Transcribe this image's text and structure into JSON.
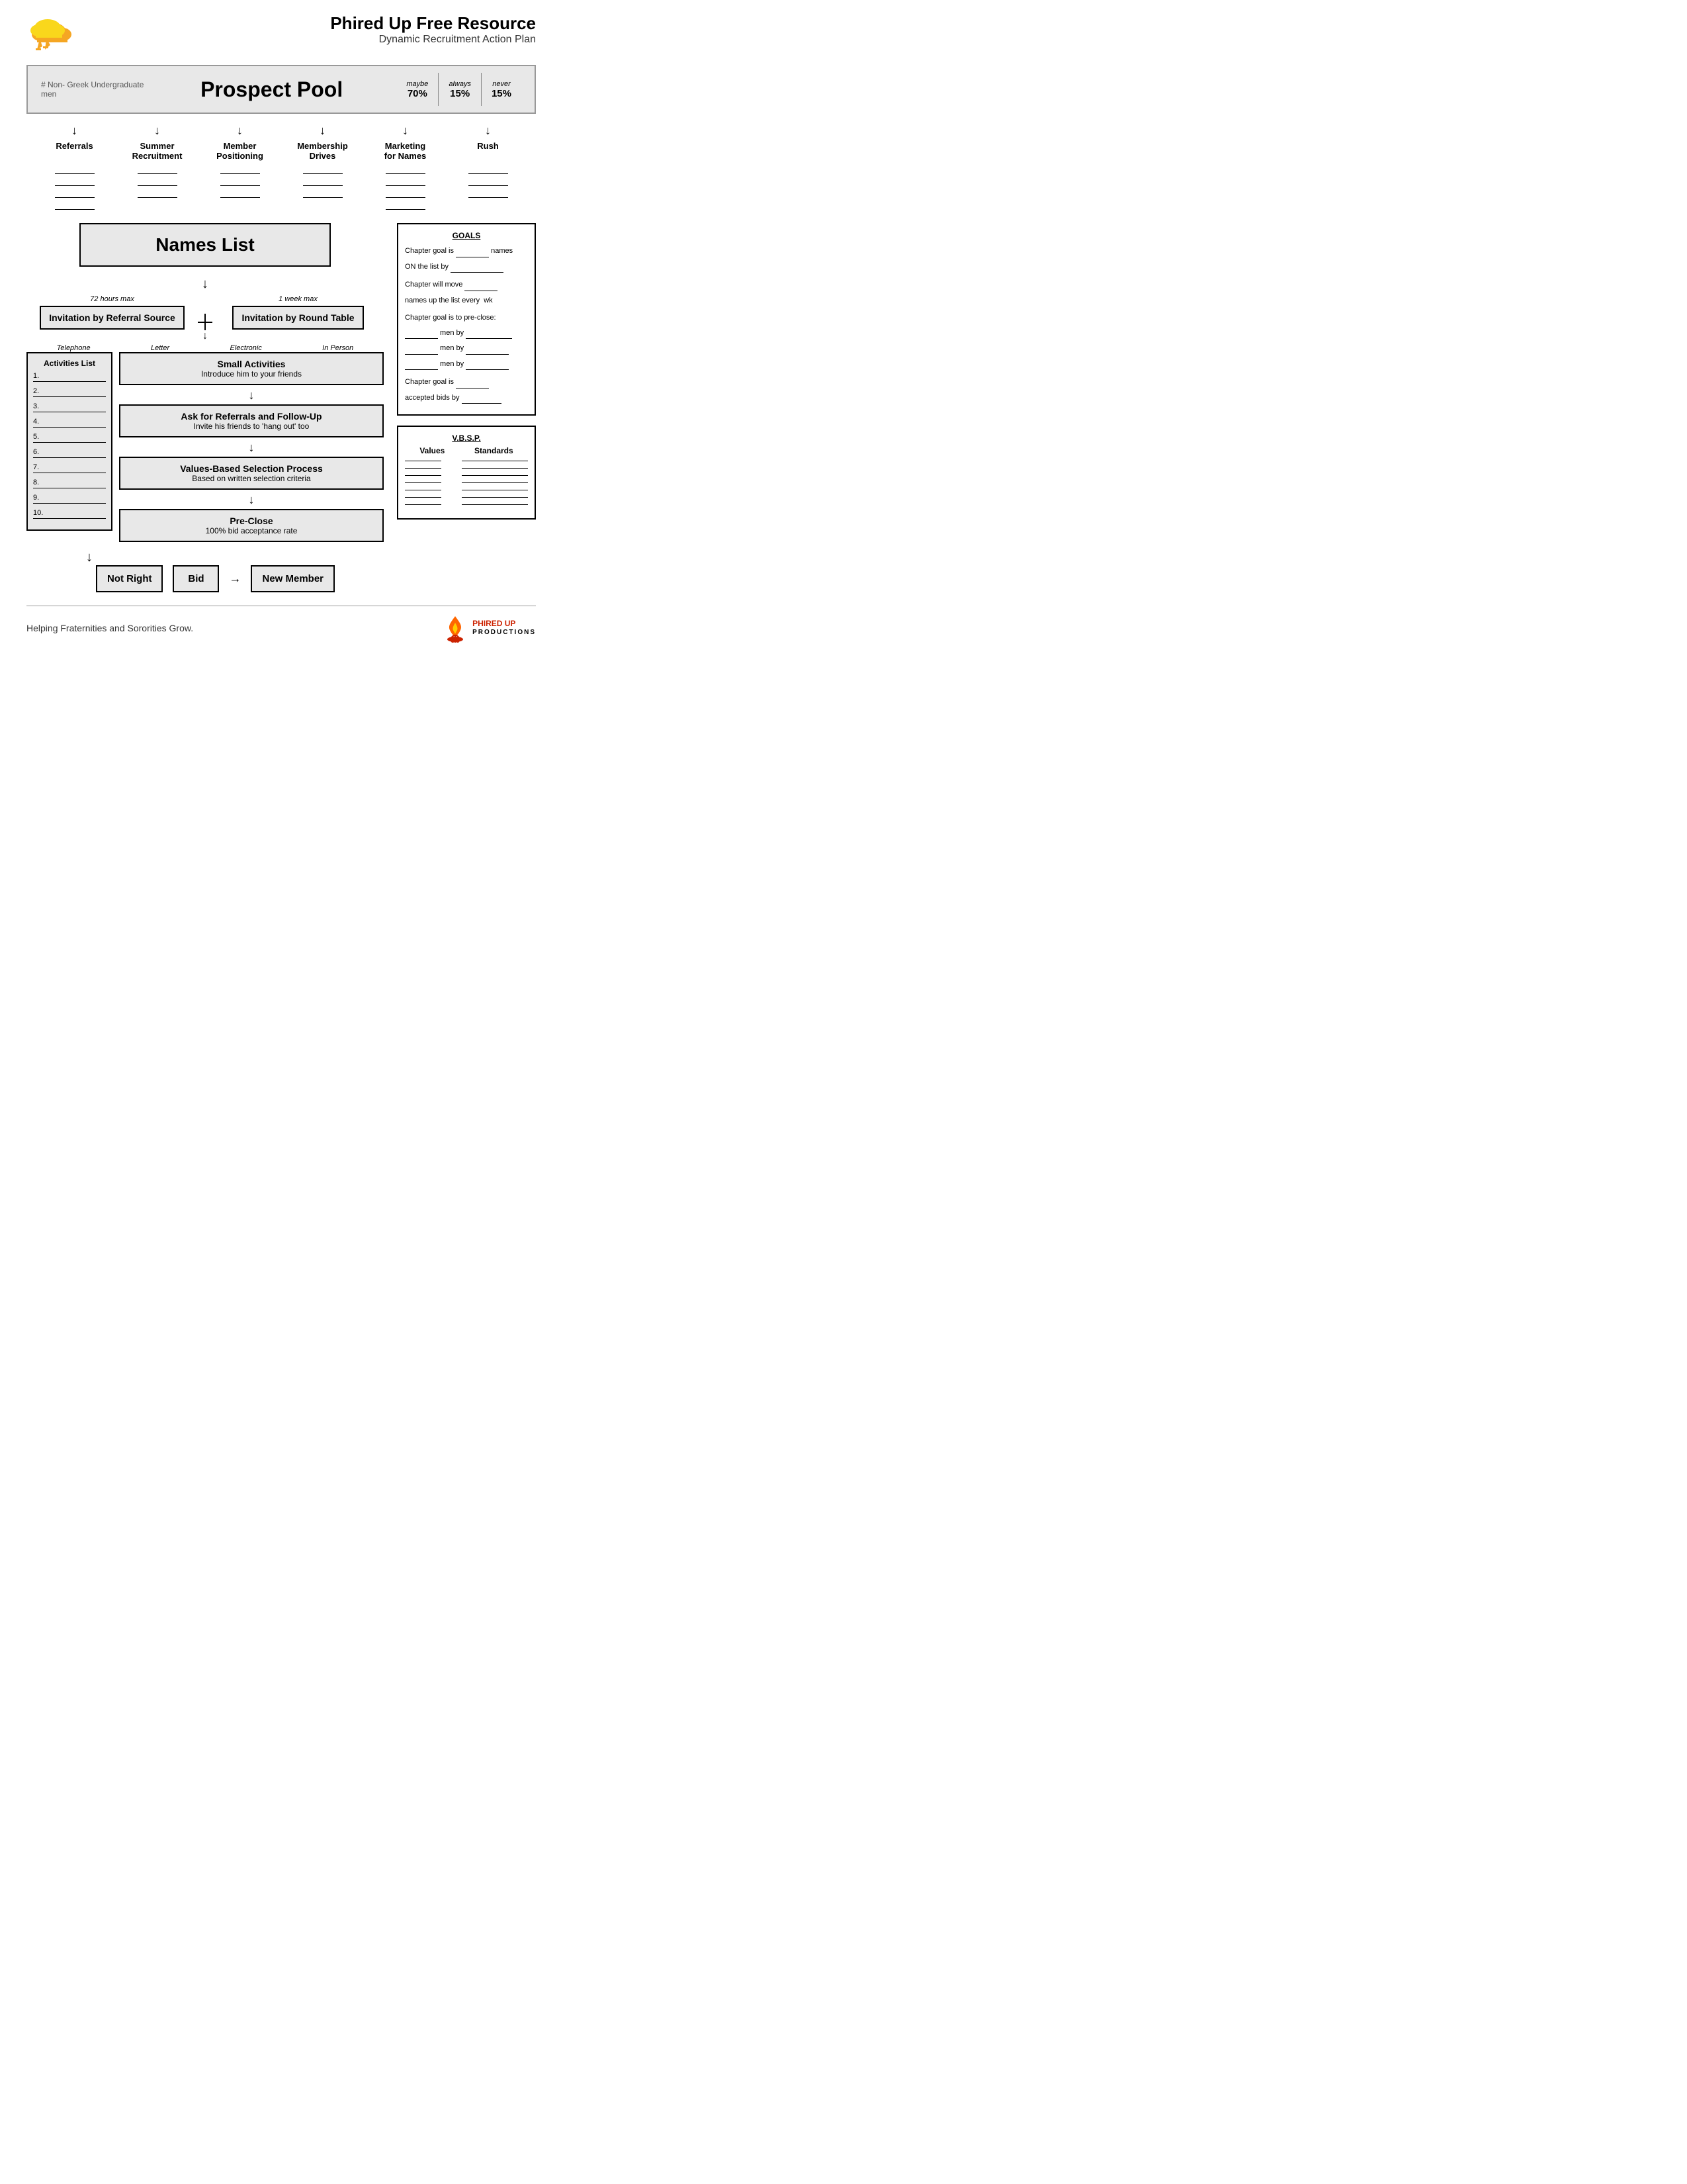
{
  "header": {
    "title": "Phired Up Free Resource",
    "subtitle": "Dynamic Recruitment Action Plan"
  },
  "prospect_pool": {
    "label": "# Non- Greek Undergraduate men",
    "title": "Prospect Pool",
    "maybe_label": "maybe",
    "maybe_value": "70%",
    "always_label": "always",
    "always_value": "15%",
    "never_label": "never",
    "never_value": "15%"
  },
  "categories": [
    {
      "label": "Referrals"
    },
    {
      "label": "Summer Recruitment"
    },
    {
      "label": "Member Positioning"
    },
    {
      "label": "Membership Drives"
    },
    {
      "label": "Marketing for Names"
    },
    {
      "label": "Rush"
    }
  ],
  "names_list": {
    "title": "Names List"
  },
  "invitation_referral": {
    "timing": "72 hours max",
    "title": "Invitation by Referral Source"
  },
  "invitation_round_table": {
    "timing": "1 week max",
    "title": "Invitation by Round Table"
  },
  "invitation_methods": {
    "telephone": "Telephone",
    "letter": "Letter",
    "electronic": "Electronic",
    "in_person": "In Person"
  },
  "activities_list": {
    "title": "Activities List",
    "items": [
      "1.",
      "2.",
      "3.",
      "4.",
      "5.",
      "6.",
      "7.",
      "8.",
      "9.",
      "10."
    ]
  },
  "flow_steps": [
    {
      "title": "Small Activities",
      "subtitle": "Introduce him to your friends"
    },
    {
      "title": "Ask for Referrals and Follow-Up",
      "subtitle": "Invite his friends to 'hang out' too"
    },
    {
      "title": "Values-Based Selection Process",
      "subtitle": "Based on written selection criteria"
    },
    {
      "title": "Pre-Close",
      "subtitle": "100% bid acceptance rate"
    }
  ],
  "outcomes": {
    "not_right": "Not Right",
    "bid": "Bid",
    "new_member": "New Member"
  },
  "goals": {
    "title": "GOALS",
    "line1": "Chapter goal is _______ names",
    "line2": "ON the list by _______________",
    "line3": "Chapter will move _______",
    "line4": "names up the list every  wk",
    "line5": "Chapter goal is to pre-close:",
    "line6": "______ men by ___________",
    "line7": "______ men by __________",
    "line8": "______ men by __________",
    "line9": "Chapter goal is _______",
    "line10": "accepted bids by _________"
  },
  "vbsp": {
    "title": "V.B.S.P.",
    "col1": "Values",
    "col2": "Standards",
    "rows": 6
  },
  "footer": {
    "tagline": "Helping Fraternities and Sororities Grow.",
    "logo_text": "PHIRED UP\nPRODUCTIONS"
  }
}
